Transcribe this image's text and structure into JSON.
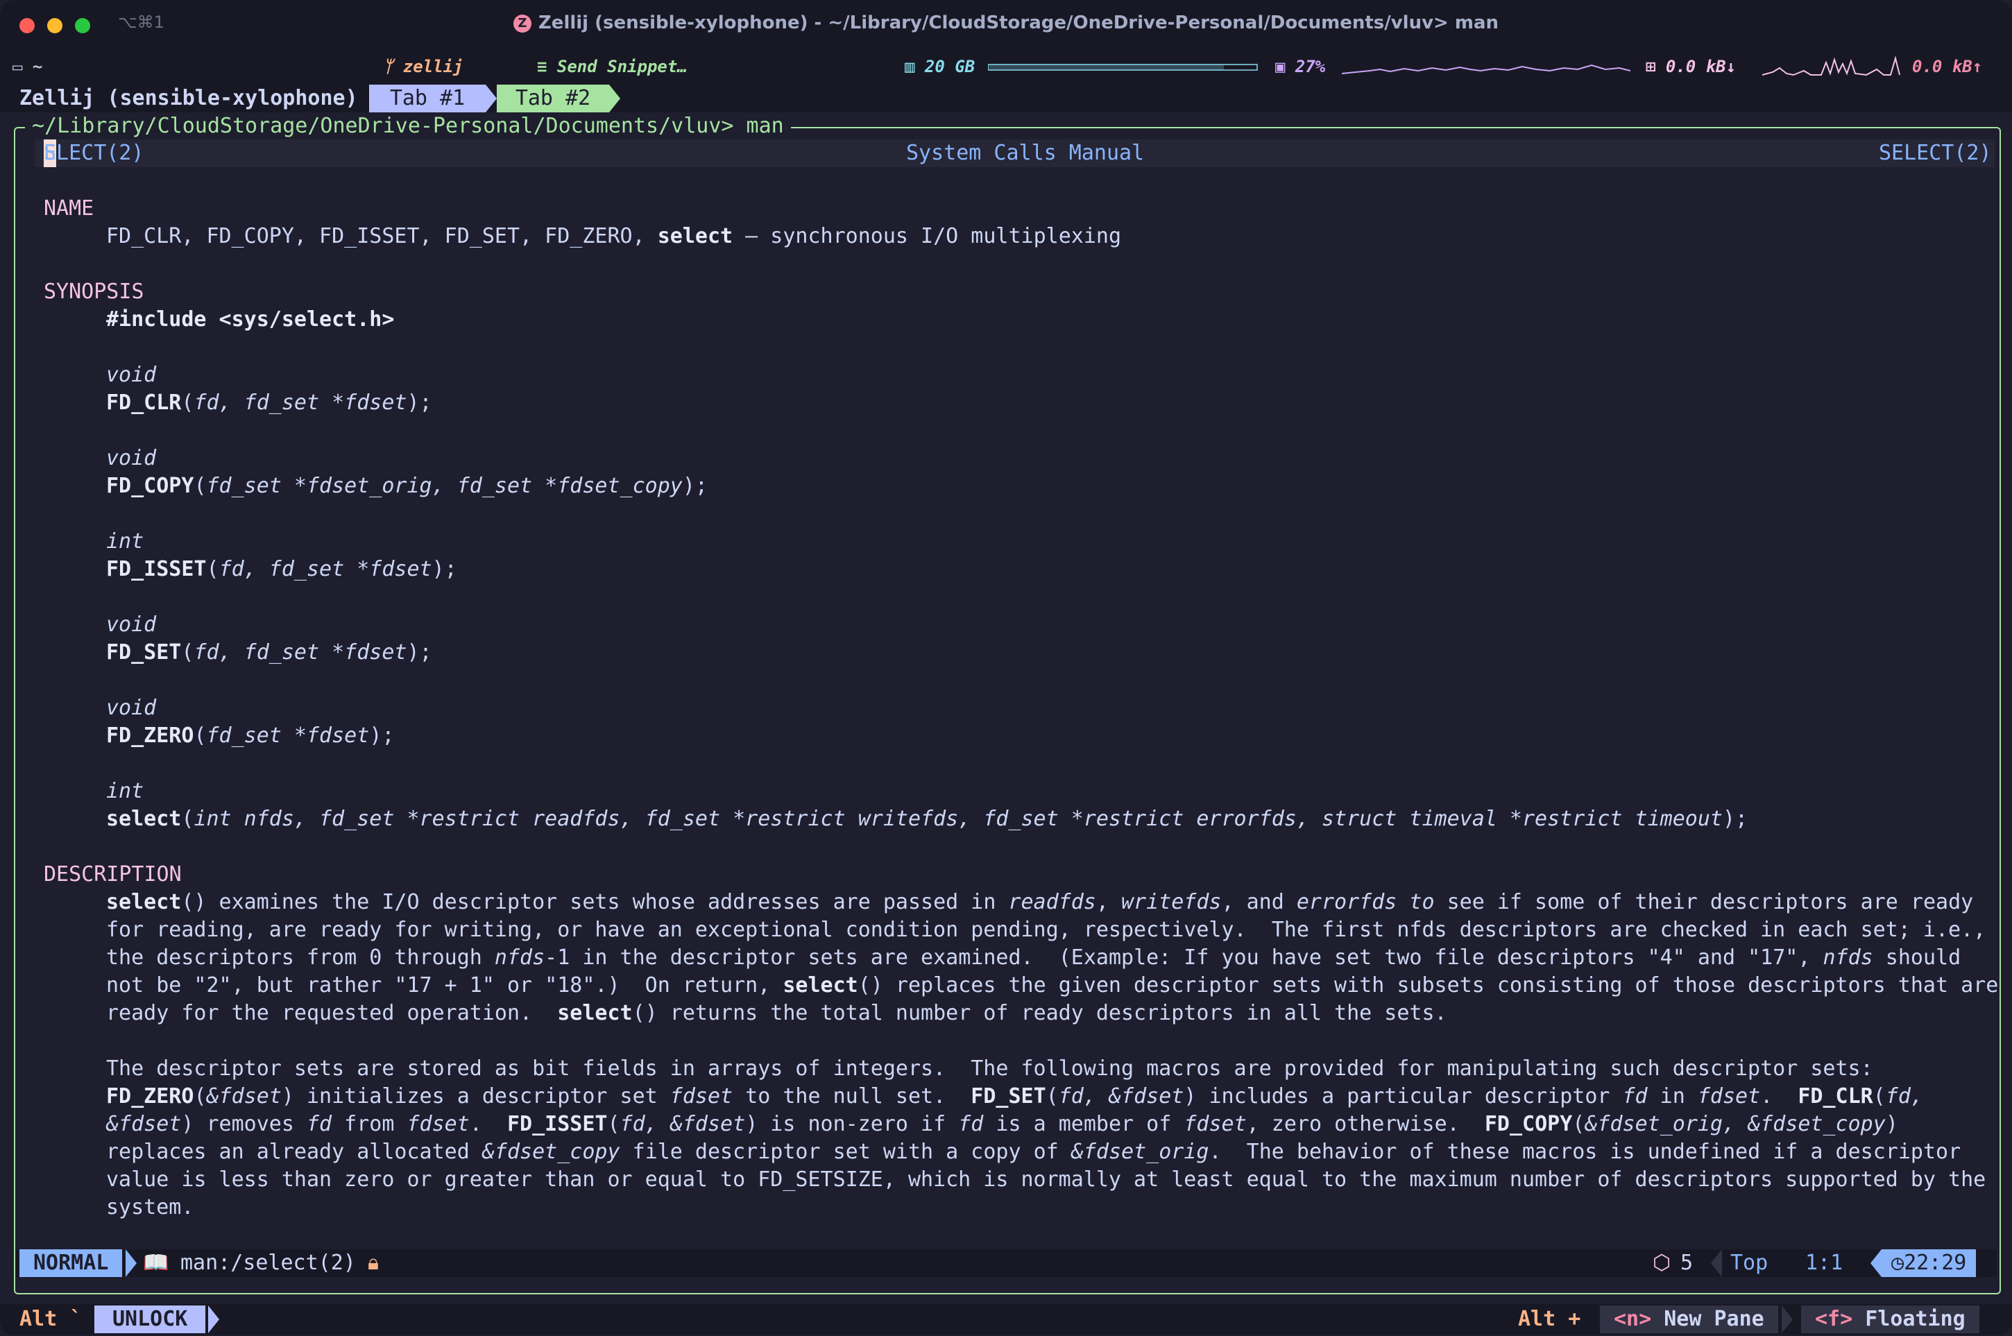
{
  "window": {
    "shortcut": "⌥⌘1",
    "title": "Zellij (sensible-xylophone) - ~/Library/CloudStorage/OneDrive-Personal/Documents/vluv> man",
    "logo_letter": "Z"
  },
  "status_strip": {
    "dir": "~",
    "app": "zellij",
    "snippet": "Send Snippet…",
    "memory": "20 GB",
    "cpu": "27%",
    "net_down": "0.0 kB↓",
    "net_up": "0.0 kB↑"
  },
  "zellij": {
    "session": "Zellij (sensible-xylophone)",
    "tabs": [
      {
        "label": "Tab #1"
      },
      {
        "label": "Tab #2"
      }
    ],
    "pane_title": "~/Library/CloudStorage/OneDrive-Personal/Documents/vluv> man"
  },
  "man": {
    "header_left_cursor": "S",
    "header_left_rest": "ELECT(2)",
    "header_center": "System Calls Manual",
    "header_right": "SELECT(2)",
    "sections": {
      "name": "NAME",
      "synopsis": "SYNOPSIS",
      "description": "DESCRIPTION"
    },
    "name_line": {
      "a": "FD_CLR, FD_COPY, FD_ISSET, FD_SET, FD_ZERO, ",
      "b": "select",
      "c": " – synchronous I/O multiplexing"
    },
    "include": "#include <sys/select.h>",
    "protos": [
      {
        "type": "void",
        "fn": "FD_CLR",
        "args": "fd, fd_set *fdset"
      },
      {
        "type": "void",
        "fn": "FD_COPY",
        "args": "fd_set *fdset_orig, fd_set *fdset_copy"
      },
      {
        "type": "int",
        "fn": "FD_ISSET",
        "args": "fd, fd_set *fdset"
      },
      {
        "type": "void",
        "fn": "FD_SET",
        "args": "fd, fd_set *fdset"
      },
      {
        "type": "void",
        "fn": "FD_ZERO",
        "args": "fd_set *fdset"
      },
      {
        "type": "int",
        "fn": "select",
        "args": "int nfds, fd_set *restrict readfds, fd_set *restrict writefds, fd_set *restrict errorfds, struct timeval *restrict timeout"
      }
    ],
    "paren_open": "(",
    "paren_close": ");",
    "d1": {
      "l1": [
        "select",
        "() examines the I/O descriptor sets whose addresses are passed in ",
        "readfds",
        ", ",
        "writefds",
        ", and ",
        "errorfds to",
        " see if some of their descriptors are ready"
      ],
      "l2": "for reading, are ready for writing, or have an exceptional condition pending, respectively.  The first nfds descriptors are checked in each set; i.e.,",
      "l3": [
        "the descriptors from 0 through ",
        "nfds",
        "-1 in the descriptor sets are examined.  (Example: If you have set two file descriptors \"4\" and \"17\", ",
        "nfds",
        " should"
      ],
      "l4": [
        "not be \"2\", but rather \"17 + 1\" or \"18\".)  On return, ",
        "select",
        "() replaces the given descriptor sets with subsets consisting of those descriptors that are"
      ],
      "l5": [
        "ready for the requested operation.  ",
        "select",
        "() returns the total number of ready descriptors in all the sets."
      ]
    },
    "d2": {
      "l1": "The descriptor sets are stored as bit fields in arrays of integers.  The following macros are provided for manipulating such descriptor sets:",
      "l2": [
        "FD_ZERO",
        "(",
        "&fdset",
        ") initializes a descriptor set ",
        "fdset",
        " to the null set.  ",
        "FD_SET",
        "(",
        "fd, &fdset",
        ") includes a particular descriptor ",
        "fd",
        " in ",
        "fdset",
        ".  ",
        "FD_CLR",
        "(",
        "fd,"
      ],
      "l3": [
        "&fdset",
        ") removes ",
        "fd",
        " from ",
        "fdset",
        ".  ",
        "FD_ISSET",
        "(",
        "fd, &fdset",
        ") is non-zero if ",
        "fd",
        " is a member of ",
        "fdset",
        ", zero otherwise.  ",
        "FD_COPY",
        "(",
        "&fdset_orig, &fdset_copy",
        ")"
      ],
      "l4": [
        "replaces an already allocated ",
        "&fdset_copy",
        " file descriptor set with a copy of ",
        "&fdset_orig",
        ".  The behavior of these macros is undefined if a descriptor"
      ],
      "l5": "value is less than zero or greater than or equal to FD_SETSIZE, which is normally at least equal to the maximum number of descriptors supported by the",
      "l6": "system."
    }
  },
  "vim": {
    "mode": "NORMAL",
    "file": "man:/select(2)",
    "count": "5",
    "position": "Top",
    "cursor": "1:1",
    "time": "22:29"
  },
  "hints": {
    "lock_key": "Alt `",
    "lock_label": "UNLOCK",
    "alt_key": "Alt +",
    "new_pane_key": "<n>",
    "new_pane_label": "New Pane",
    "floating_key": "<f>",
    "floating_label": "Floating"
  },
  "colors": {
    "accent": "#89b4fa",
    "green": "#a6e3a1",
    "pink": "#f5c2e7",
    "background": "#1e1e2e"
  }
}
